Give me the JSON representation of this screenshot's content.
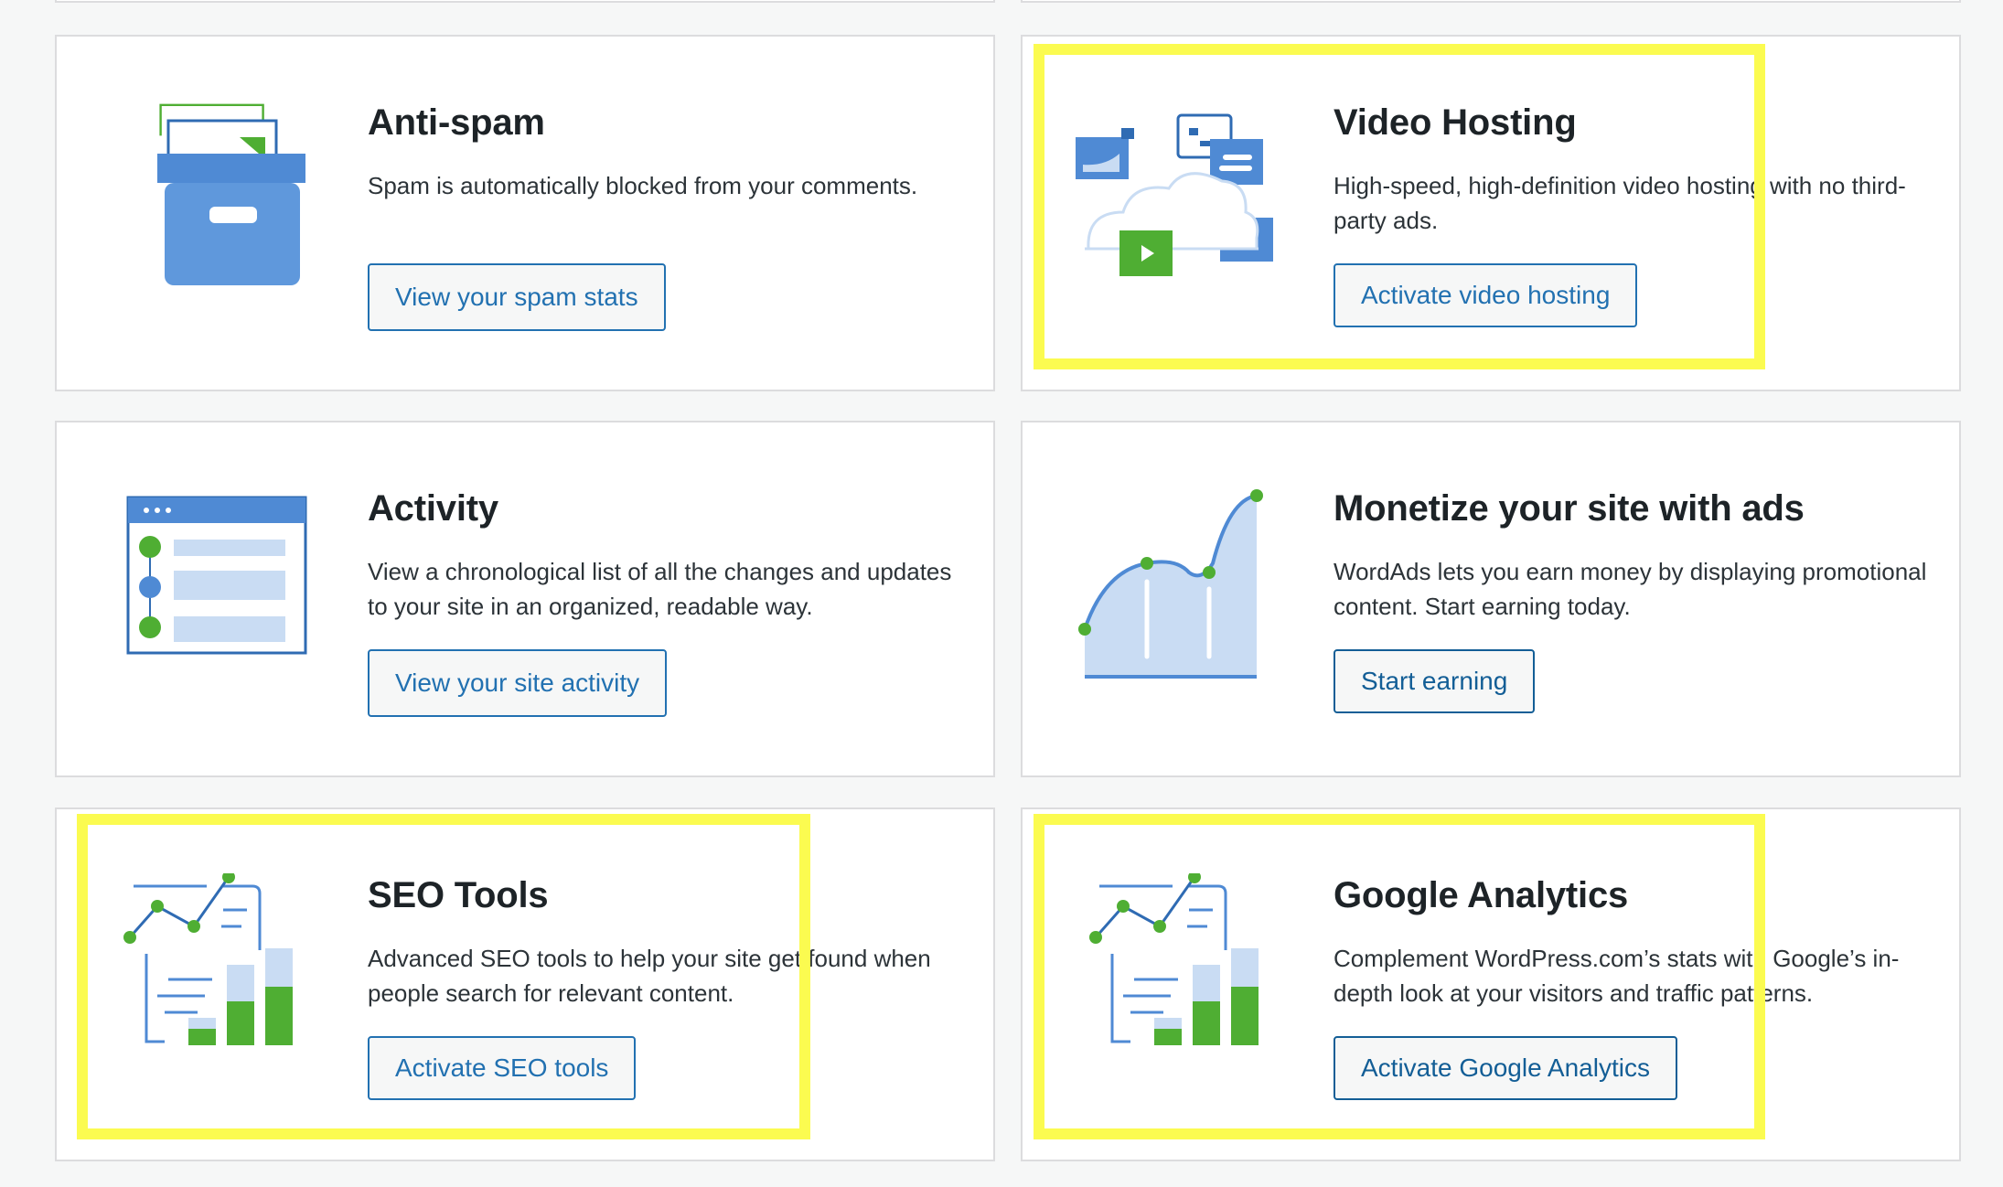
{
  "cards": {
    "anti_spam": {
      "title": "Anti-spam",
      "description": "Spam is automatically blocked from your comments.",
      "button": "View your spam stats",
      "icon": "archive-box-icon"
    },
    "video_hosting": {
      "title": "Video Hosting",
      "description": "High-speed, high-definition video hosting with no third-party ads.",
      "button": "Activate video hosting",
      "icon": "video-cloud-icon"
    },
    "activity": {
      "title": "Activity",
      "description": "View a chronological list of all the changes and updates to your site in an organized, readable way.",
      "button": "View your site activity",
      "icon": "activity-log-icon"
    },
    "ads": {
      "title": "Monetize your site with ads",
      "description": "WordAds lets you earn money by displaying promotional content. Start earning today.",
      "button": "Start earning",
      "icon": "earnings-chart-icon"
    },
    "seo": {
      "title": "SEO Tools",
      "description": "Advanced SEO tools to help your site get found when people search for relevant content.",
      "button": "Activate SEO tools",
      "icon": "seo-chart-icon"
    },
    "analytics": {
      "title": "Google Analytics",
      "description": "Complement WordPress.com’s stats with Google’s in-depth look at your visitors and traffic patterns.",
      "button": "Activate Google Analytics",
      "icon": "analytics-chart-icon"
    }
  },
  "colors": {
    "accent_blue": "#2271b1",
    "illustration_blue": "#4f8ad4",
    "illustration_light_blue": "#c9dcf3",
    "illustration_green": "#4fae33",
    "highlight_yellow": "#fbfb50"
  }
}
